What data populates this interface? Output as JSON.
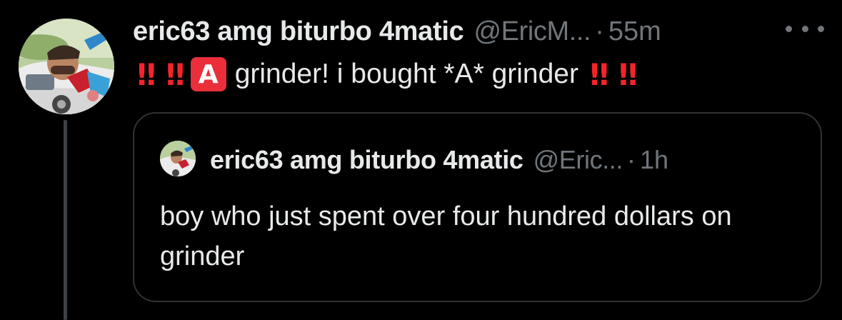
{
  "tweet": {
    "author": {
      "display_name": "eric63 amg biturbo 4matic",
      "handle": "@EricM...",
      "separator": "·",
      "time": "55m"
    },
    "avatar_icon": "profile-photo",
    "more_icon": "more-dots-icon",
    "body": {
      "bang1": "‼",
      "bang2": "‼",
      "a_emoji": "A",
      "text": "grinder! i bought *A* grinder",
      "bang3": "‼",
      "bang4": "‼"
    }
  },
  "quoted_tweet": {
    "author": {
      "display_name": "eric63 amg biturbo 4matic",
      "handle": "@Eric...",
      "separator": "·",
      "time": "1h"
    },
    "text": "boy who just spent over four hundred dollars on grinder"
  },
  "colors": {
    "background": "#000000",
    "text_primary": "#e7e9ea",
    "text_secondary": "#71767b",
    "border": "#2f3336",
    "emoji_red": "#f4232c"
  }
}
